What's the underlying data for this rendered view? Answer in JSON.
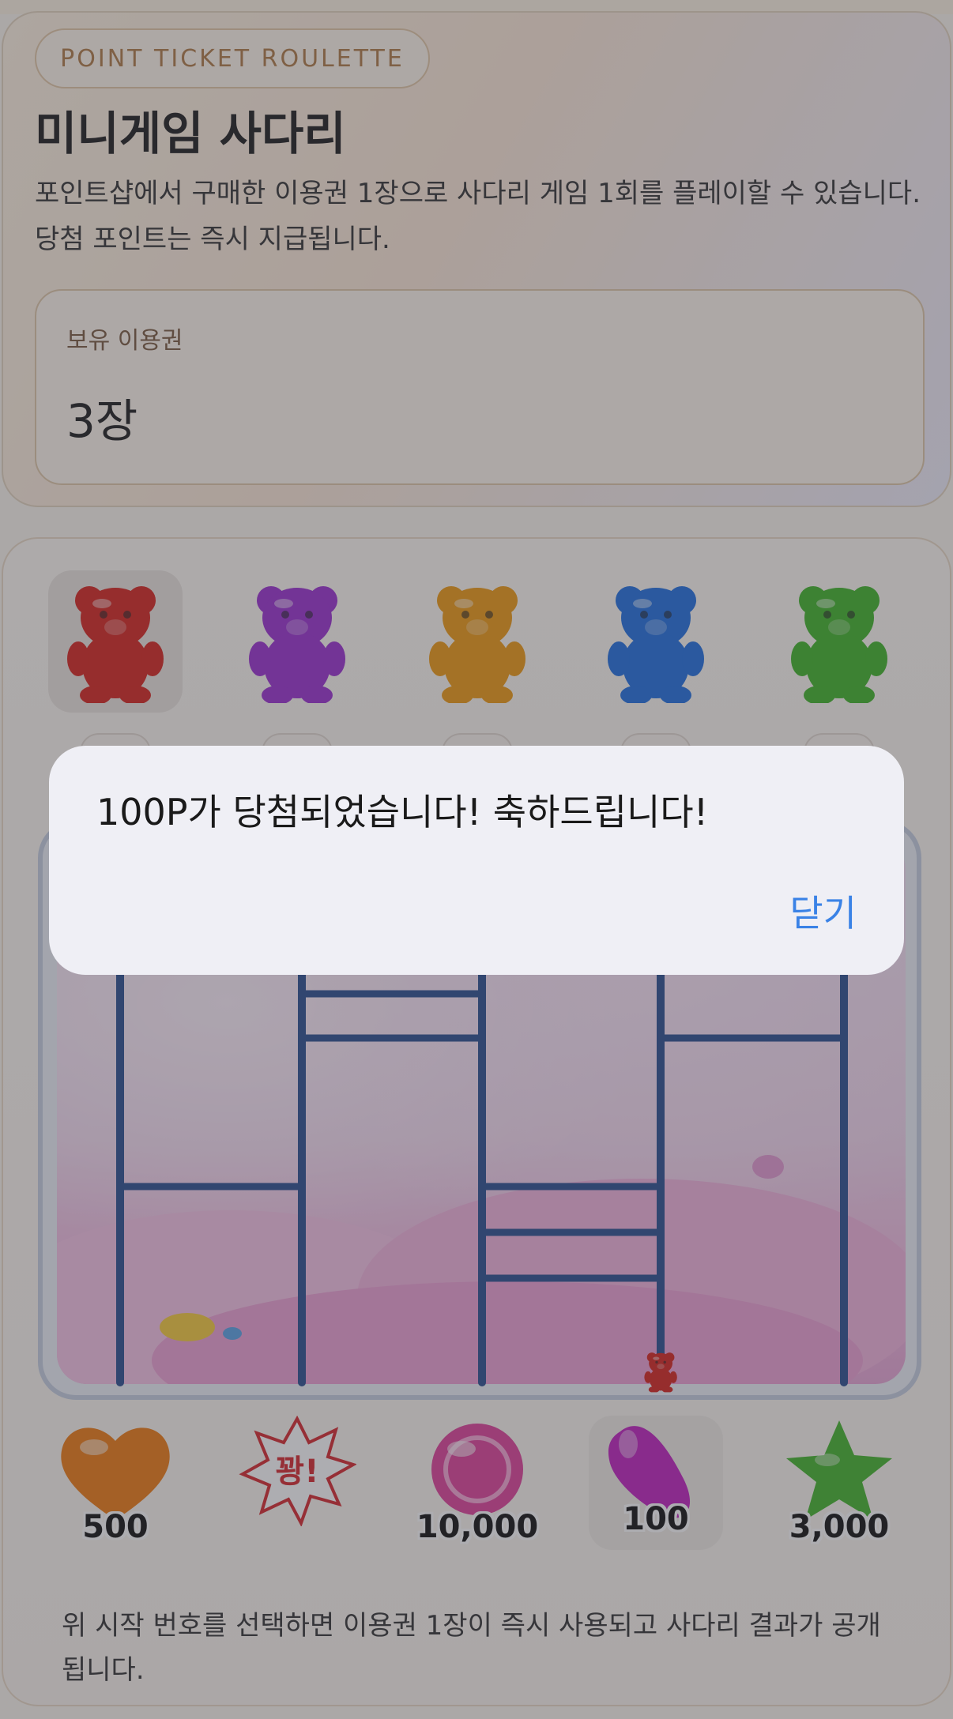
{
  "header": {
    "pill_label": "POINT TICKET ROULETTE",
    "title": "미니게임 사다리",
    "description": "포인트샵에서 구매한 이용권 1장으로 사다리 게임 1회를 플레이할 수 있습니다. 당첨 포인트는 즉시 지급됩니다.",
    "ticket_label": "보유 이용권",
    "ticket_value": "3장"
  },
  "game": {
    "bears": [
      {
        "icon": "red-gummy-bear-icon",
        "color": "#d8241c",
        "selected": true
      },
      {
        "icon": "purple-gummy-bear-icon",
        "color": "#9b2fd1",
        "selected": false
      },
      {
        "icon": "orange-gummy-bear-icon",
        "color": "#f09a10",
        "selected": false
      },
      {
        "icon": "blue-gummy-bear-icon",
        "color": "#1f6fe0",
        "selected": false
      },
      {
        "icon": "green-gummy-bear-icon",
        "color": "#3fb526",
        "selected": false
      }
    ],
    "prizes": [
      {
        "icon": "orange-heart-candy-icon",
        "label": "500",
        "color": "#ef7a10"
      },
      {
        "icon": "bang-burst-icon",
        "label": "꽝!",
        "color": "#d8262c"
      },
      {
        "icon": "pink-lollipop-icon",
        "label": "10,000",
        "color": "#e0409a"
      },
      {
        "icon": "purple-jellybean-icon",
        "label": "100",
        "color": "#c21fc0",
        "selected": true
      },
      {
        "icon": "green-star-candy-icon",
        "label": "3,000",
        "color": "#43b52a"
      }
    ],
    "footer_note": "위 시작 번호를 선택하면 이용권 1장이 즉시 사용되고 사다리 결과가 공개됩니다.",
    "ladder_color": "#2a4f8f"
  },
  "alert": {
    "message": "100P가 당첨되었습니다! 축하드립니다!",
    "close_label": "닫기"
  }
}
